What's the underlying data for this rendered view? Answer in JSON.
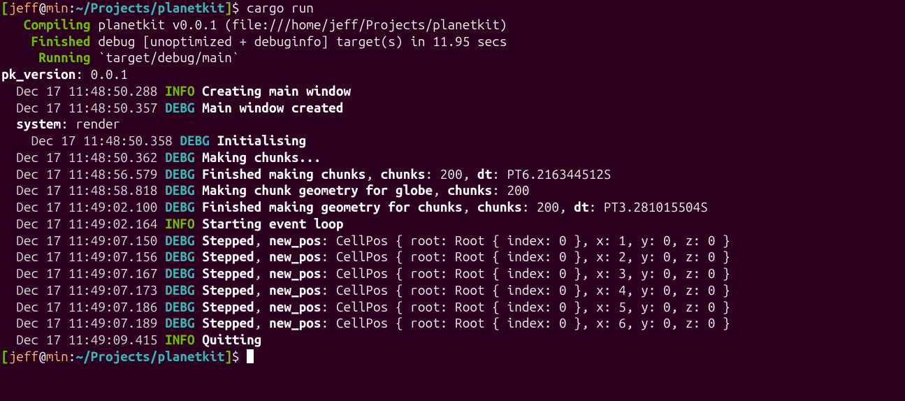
{
  "prompt": {
    "lbracket": "[",
    "user": "jeff",
    "at": "@",
    "host": "min",
    "colon": ":",
    "path": "~/Projects/planetkit",
    "rbracket": "]",
    "sigil": "$ ",
    "command": "cargo run"
  },
  "cargo": {
    "compiling_label": "   Compiling ",
    "compiling_body": "planetkit v0.0.1 (file:///home/jeff/Projects/planetkit)",
    "finished_label": "    Finished ",
    "finished_body": "debug [unoptimized + debuginfo] target(s) in 11.95 secs",
    "running_label": "     Running ",
    "running_body": "`target/debug/main`"
  },
  "version": {
    "key": "pk_version",
    "sep": ": ",
    "val": "0.0.1"
  },
  "logs": [
    {
      "indent": "  ",
      "ts": "Dec 17 11:48:50.288 ",
      "level": "INFO",
      "space": " ",
      "msg": "Creating main window",
      "tail": ""
    },
    {
      "indent": "  ",
      "ts": "Dec 17 11:48:50.357 ",
      "level": "DEBG",
      "space": " ",
      "msg": "Main window created",
      "tail": ""
    }
  ],
  "system": {
    "indent": "  ",
    "key": "system",
    "sep": ": ",
    "val": "render"
  },
  "logs2": [
    {
      "indent": "    ",
      "ts": "Dec 17 11:48:50.358 ",
      "level": "DEBG",
      "space": " ",
      "msg": "Initialising",
      "tail": ""
    },
    {
      "indent": "  ",
      "ts": "Dec 17 11:48:50.362 ",
      "level": "DEBG",
      "space": " ",
      "msg": "Making chunks...",
      "tail": ""
    },
    {
      "indent": "  ",
      "ts": "Dec 17 11:48:56.579 ",
      "level": "DEBG",
      "space": " ",
      "parts": [
        {
          "b": "Finished making chunks"
        },
        {
          "t": ", "
        },
        {
          "b": "chunks"
        },
        {
          "t": ": 200, "
        },
        {
          "b": "dt"
        },
        {
          "t": ": PT6.216344512S"
        }
      ]
    },
    {
      "indent": "  ",
      "ts": "Dec 17 11:48:58.818 ",
      "level": "DEBG",
      "space": " ",
      "parts": [
        {
          "b": "Making chunk geometry for globe"
        },
        {
          "t": ", "
        },
        {
          "b": "chunks"
        },
        {
          "t": ": 200"
        }
      ]
    },
    {
      "indent": "  ",
      "ts": "Dec 17 11:49:02.100 ",
      "level": "DEBG",
      "space": " ",
      "parts": [
        {
          "b": "Finished making geometry for chunks"
        },
        {
          "t": ", "
        },
        {
          "b": "chunks"
        },
        {
          "t": ": 200, "
        },
        {
          "b": "dt"
        },
        {
          "t": ": PT3.281015504S"
        }
      ]
    },
    {
      "indent": "  ",
      "ts": "Dec 17 11:49:02.164 ",
      "level": "INFO",
      "space": " ",
      "msg": "Starting event loop",
      "tail": ""
    },
    {
      "indent": "  ",
      "ts": "Dec 17 11:49:07.150 ",
      "level": "DEBG",
      "space": " ",
      "parts": [
        {
          "b": "Stepped"
        },
        {
          "t": ", "
        },
        {
          "b": "new_pos"
        },
        {
          "t": ": CellPos { root: Root { index: 0 }, x: 1, y: 0, z: 0 }"
        }
      ]
    },
    {
      "indent": "  ",
      "ts": "Dec 17 11:49:07.156 ",
      "level": "DEBG",
      "space": " ",
      "parts": [
        {
          "b": "Stepped"
        },
        {
          "t": ", "
        },
        {
          "b": "new_pos"
        },
        {
          "t": ": CellPos { root: Root { index: 0 }, x: 2, y: 0, z: 0 }"
        }
      ]
    },
    {
      "indent": "  ",
      "ts": "Dec 17 11:49:07.167 ",
      "level": "DEBG",
      "space": " ",
      "parts": [
        {
          "b": "Stepped"
        },
        {
          "t": ", "
        },
        {
          "b": "new_pos"
        },
        {
          "t": ": CellPos { root: Root { index: 0 }, x: 3, y: 0, z: 0 }"
        }
      ]
    },
    {
      "indent": "  ",
      "ts": "Dec 17 11:49:07.173 ",
      "level": "DEBG",
      "space": " ",
      "parts": [
        {
          "b": "Stepped"
        },
        {
          "t": ", "
        },
        {
          "b": "new_pos"
        },
        {
          "t": ": CellPos { root: Root { index: 0 }, x: 4, y: 0, z: 0 }"
        }
      ]
    },
    {
      "indent": "  ",
      "ts": "Dec 17 11:49:07.186 ",
      "level": "DEBG",
      "space": " ",
      "parts": [
        {
          "b": "Stepped"
        },
        {
          "t": ", "
        },
        {
          "b": "new_pos"
        },
        {
          "t": ": CellPos { root: Root { index: 0 }, x: 5, y: 0, z: 0 }"
        }
      ]
    },
    {
      "indent": "  ",
      "ts": "Dec 17 11:49:07.189 ",
      "level": "DEBG",
      "space": " ",
      "parts": [
        {
          "b": "Stepped"
        },
        {
          "t": ", "
        },
        {
          "b": "new_pos"
        },
        {
          "t": ": CellPos { root: Root { index: 0 }, x: 6, y: 0, z: 0 }"
        }
      ]
    },
    {
      "indent": "  ",
      "ts": "Dec 17 11:49:09.415 ",
      "level": "INFO",
      "space": " ",
      "msg": "Quitting",
      "tail": ""
    }
  ],
  "prompt2": {
    "lbracket": "[",
    "user": "jeff",
    "at": "@",
    "host": "min",
    "colon": ":",
    "path": "~/Projects/planetkit",
    "rbracket": "]",
    "sigil": "$ "
  },
  "level_colors": {
    "INFO": "green-bold",
    "DEBG": "cyan-bold"
  }
}
